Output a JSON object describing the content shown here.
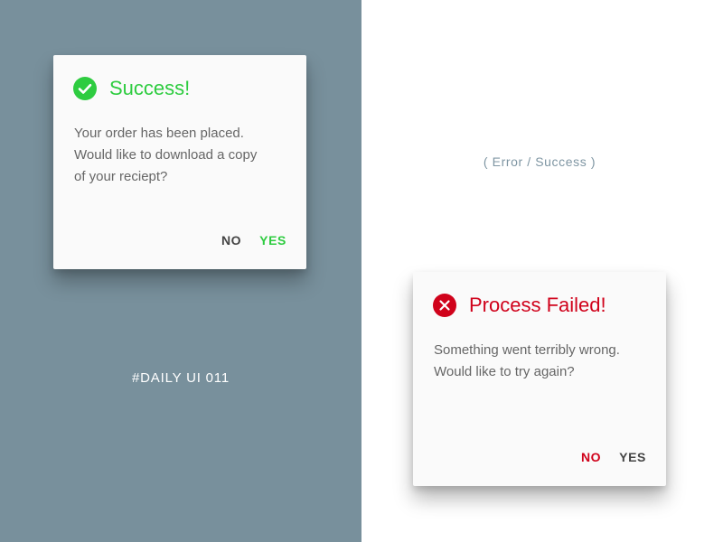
{
  "theme": {
    "left_bg": "#78909c",
    "right_bg": "#ffffff",
    "success_color": "#2ecc40",
    "error_color": "#d0021b",
    "neutral_button_color": "#444444"
  },
  "success_dialog": {
    "icon": "check-circle-icon",
    "title": "Success!",
    "message_lines": [
      "Your order has been placed.",
      "Would like to download a copy",
      "of your reciept?"
    ],
    "no_label": "NO",
    "yes_label": "YES"
  },
  "failed_dialog": {
    "icon": "x-circle-icon",
    "title": "Process Failed!",
    "message_lines": [
      "Something went terribly wrong.",
      "Would like to try again?"
    ],
    "no_label": "NO",
    "yes_label": "YES"
  },
  "tag": "#DAILY UI 011",
  "caption": "( Error / Success )"
}
